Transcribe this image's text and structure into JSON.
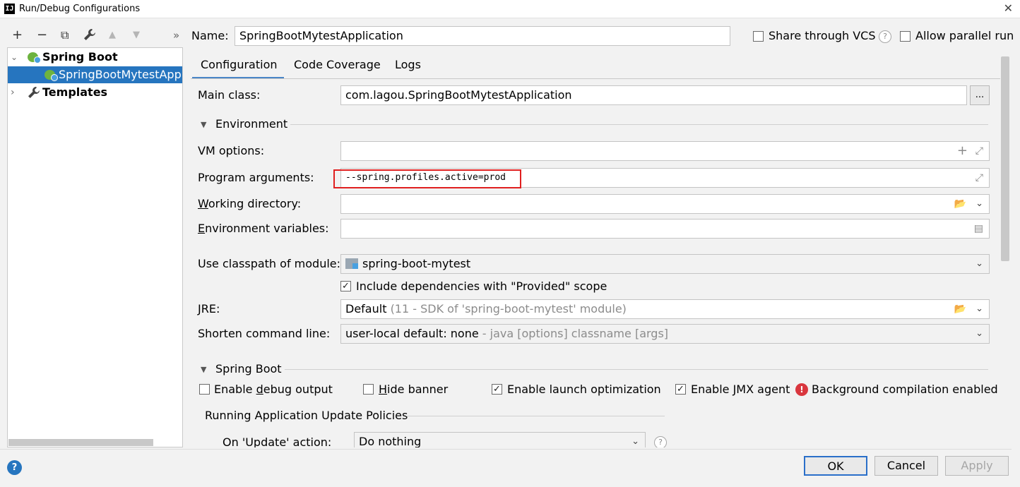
{
  "window": {
    "title": "Run/Debug Configurations",
    "logo_text": "IJ"
  },
  "toolbar": {
    "icons": [
      "add-icon",
      "remove-icon",
      "copy-icon",
      "wrench-icon",
      "arrow-up-icon",
      "arrow-down-icon",
      "more-icon"
    ],
    "glyphs": [
      "+",
      "−",
      "⧉",
      "🔧",
      "▲",
      "▼",
      "»"
    ]
  },
  "tree": {
    "items": [
      {
        "label": "Spring Boot",
        "bold": true,
        "expanded": true
      },
      {
        "label": "SpringBootMytestApplication",
        "selected": true
      },
      {
        "label": "Templates",
        "bold": true,
        "expanded": false
      }
    ]
  },
  "header": {
    "name_label": "Name:",
    "name_value": "SpringBootMytestApplication",
    "share_vcs_label": "Share through VCS",
    "allow_parallel_label": "Allow parallel run"
  },
  "tabs": [
    {
      "label": "Configuration",
      "active": true
    },
    {
      "label": "Code Coverage"
    },
    {
      "label": "Logs"
    }
  ],
  "form": {
    "main_class_label": "Main class:",
    "main_class_value": "com.lagou.SpringBootMytestApplication",
    "main_class_browse": "...",
    "environment_section": "Environment",
    "vm_options_label": "VM options:",
    "vm_options_value": "",
    "program_args_label": "Program arguments:",
    "program_args_value": "--spring.profiles.active=prod",
    "working_dir_label": "Working directory:",
    "working_dir_value": "",
    "env_vars_label": "Environment variables:",
    "env_vars_value": "",
    "classpath_label": "Use classpath of module:",
    "classpath_value": "spring-boot-mytest",
    "include_deps_label": "Include dependencies with \"Provided\" scope",
    "include_deps_checked": true,
    "jre_label": "JRE:",
    "jre_value": "Default",
    "jre_hint": "(11 - SDK of 'spring-boot-mytest' module)",
    "shorten_label": "Shorten command line:",
    "shorten_value": "user-local default: none",
    "shorten_hint": "- java [options] classname [args]",
    "spring_boot_section": "Spring Boot",
    "enable_debug_label": "Enable debug output",
    "enable_debug_checked": false,
    "hide_banner_label": "Hide banner",
    "hide_banner_checked": false,
    "launch_opt_label": "Enable launch optimization",
    "launch_opt_checked": true,
    "jmx_label": "Enable JMX agent",
    "jmx_checked": true,
    "bg_compile_label": "Background compilation enabled",
    "update_policies_section": "Running Application Update Policies",
    "on_update_label": "On 'Update' action:",
    "on_update_value": "Do nothing"
  },
  "buttons": {
    "ok": "OK",
    "cancel": "Cancel",
    "apply": "Apply"
  },
  "colors": {
    "selection": "#2675bf",
    "highlight_box": "#e02020",
    "error": "#d9363e",
    "ok_border": "#2a6fc9"
  }
}
